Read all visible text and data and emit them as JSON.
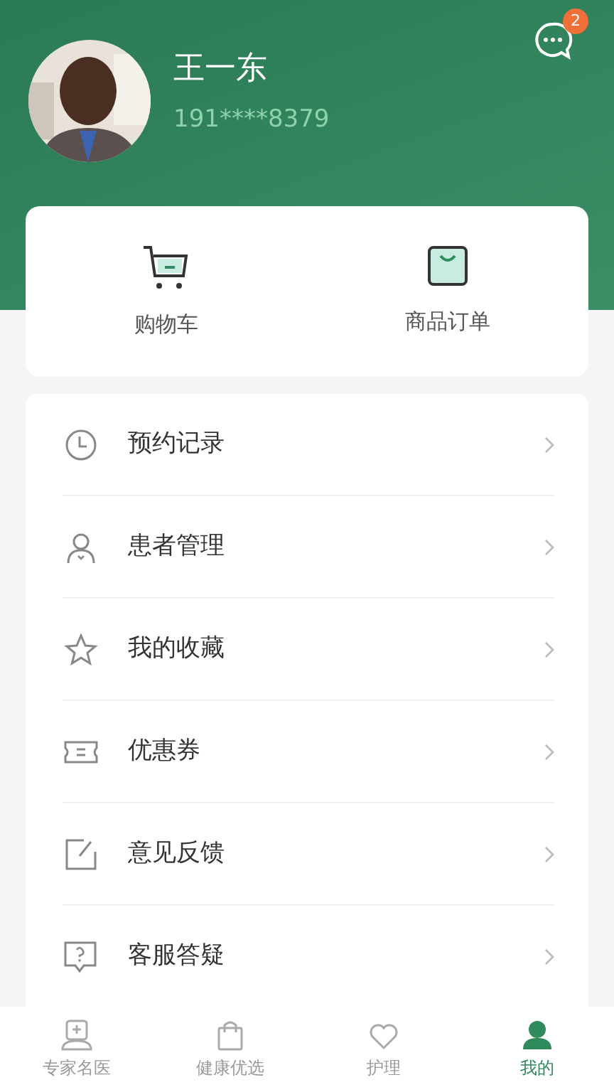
{
  "profile": {
    "name": "王一东",
    "phone": "191****8379"
  },
  "messages": {
    "badge": "2"
  },
  "shortcuts": [
    {
      "label": "购物车",
      "kind": "cart"
    },
    {
      "label": "商品订单",
      "kind": "bag"
    }
  ],
  "menu": [
    {
      "label": "预约记录",
      "kind": "clock"
    },
    {
      "label": "患者管理",
      "kind": "person"
    },
    {
      "label": "我的收藏",
      "kind": "star"
    },
    {
      "label": "优惠券",
      "kind": "ticket"
    },
    {
      "label": "意见反馈",
      "kind": "edit"
    },
    {
      "label": "客服答疑",
      "kind": "help"
    }
  ],
  "tabbar": [
    {
      "label": "专家名医",
      "kind": "doctor",
      "selected": false
    },
    {
      "label": "健康优选",
      "kind": "bag",
      "selected": false
    },
    {
      "label": "护理",
      "kind": "care",
      "selected": false
    },
    {
      "label": "我的",
      "kind": "me",
      "selected": true
    }
  ]
}
